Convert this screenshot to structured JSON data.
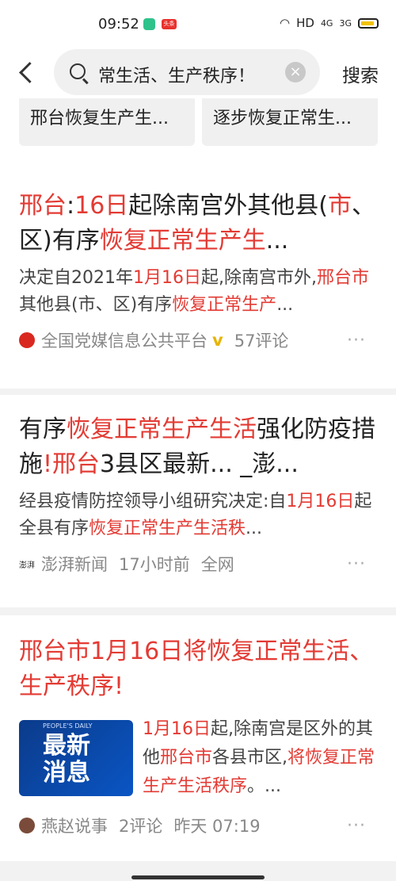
{
  "status": {
    "time": "09:52",
    "app_badge": "头条",
    "signal_text": "HD",
    "net1": "4G",
    "net2": "3G"
  },
  "search": {
    "query": "常生活、生产秩序！",
    "button": "搜索"
  },
  "related": [
    "邢台恢复生产生...",
    "逐步恢复正常生..."
  ],
  "results": [
    {
      "title_parts": [
        {
          "t": "邢台",
          "hl": true
        },
        {
          "t": ":",
          "hl": false
        },
        {
          "t": "16日",
          "hl": true
        },
        {
          "t": "起除南宫外其他县",
          "hl": false
        },
        {
          "t": "(",
          "hl": false
        },
        {
          "t": "市",
          "hl": true
        },
        {
          "t": "、区)有序",
          "hl": false
        },
        {
          "t": "恢复正常生产生",
          "hl": true
        },
        {
          "t": "...",
          "hl": false
        }
      ],
      "snippet_parts": [
        {
          "t": "决定自2021年",
          "hl": false
        },
        {
          "t": "1月16日",
          "hl": true
        },
        {
          "t": "起,除南宫市外,",
          "hl": false
        },
        {
          "t": "邢台市",
          "hl": true
        },
        {
          "t": "其他县(市、区)有序",
          "hl": false
        },
        {
          "t": "恢复正常生产",
          "hl": true
        },
        {
          "t": "...",
          "hl": false
        }
      ],
      "source": "全国党媒信息公共平台",
      "verified": "v",
      "comments": "57评论"
    },
    {
      "title_parts": [
        {
          "t": "有序",
          "hl": false
        },
        {
          "t": "恢复正常生产生活",
          "hl": true
        },
        {
          "t": "强化防疫措施",
          "hl": false
        },
        {
          "t": "!",
          "hl": true
        },
        {
          "t": "邢台",
          "hl": true
        },
        {
          "t": "3县区最新... _澎...",
          "hl": false
        }
      ],
      "snippet_parts": [
        {
          "t": "经县疫情防控领导小组研究决定:自",
          "hl": false
        },
        {
          "t": "1月16日",
          "hl": true
        },
        {
          "t": "起全县有序",
          "hl": false
        },
        {
          "t": "恢复正常生产生活秩",
          "hl": true
        },
        {
          "t": "...",
          "hl": false
        }
      ],
      "source_logo": "澎湃",
      "source": "澎湃新闻",
      "time": "17小时前",
      "scope": "全网"
    },
    {
      "title_parts": [
        {
          "t": "邢台市1月16日将恢复正常生活、生产秩序!",
          "hl": true
        }
      ],
      "thumb": {
        "top": "PEOPLE'S DAILY",
        "line1": "最新",
        "line2": "消息"
      },
      "snippet_parts": [
        {
          "t": "1月16日",
          "hl": true
        },
        {
          "t": "起,除南宫是区外的其他",
          "hl": false
        },
        {
          "t": "邢台市",
          "hl": true
        },
        {
          "t": "各县市区,",
          "hl": false
        },
        {
          "t": "将恢复正常生产生活秩序",
          "hl": true
        },
        {
          "t": "。...",
          "hl": false
        }
      ],
      "source": "燕赵说事",
      "comments": "2评论",
      "time": "昨天 07:19"
    }
  ],
  "more": "···"
}
